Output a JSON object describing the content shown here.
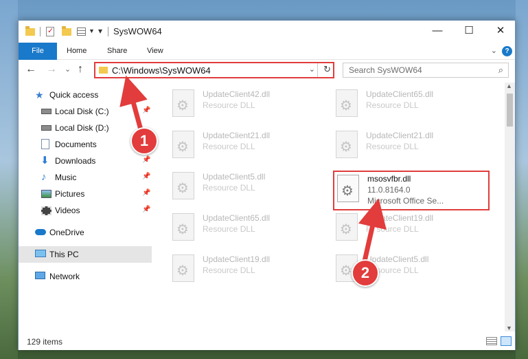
{
  "window": {
    "title": "SysWOW64",
    "minimize_glyph": "—",
    "maximize_glyph": "☐",
    "close_glyph": "✕"
  },
  "ribbon": {
    "tabs": [
      "File",
      "Home",
      "Share",
      "View"
    ],
    "help_glyph": "?"
  },
  "nav": {
    "back_glyph": "←",
    "forward_glyph": "→",
    "recent_glyph": "⌄",
    "up_glyph": "↑",
    "address": "C:\\Windows\\SysWOW64",
    "search_placeholder": "Search SysWOW64"
  },
  "sidebar": {
    "items": [
      {
        "label": "Quick access",
        "icon": "star-icon"
      },
      {
        "label": "Local Disk (C:)",
        "icon": "drive-icon"
      },
      {
        "label": "Local Disk (D:)",
        "icon": "drive-icon"
      },
      {
        "label": "Documents",
        "icon": "documents-icon"
      },
      {
        "label": "Downloads",
        "icon": "download-icon"
      },
      {
        "label": "Music",
        "icon": "music-icon"
      },
      {
        "label": "Pictures",
        "icon": "pictures-icon"
      },
      {
        "label": "Videos",
        "icon": "videos-icon"
      },
      {
        "label": "OneDrive",
        "icon": "cloud-icon"
      },
      {
        "label": "This PC",
        "icon": "pc-icon"
      },
      {
        "label": "Network",
        "icon": "network-icon"
      }
    ]
  },
  "files": {
    "left_col": [
      {
        "name": "UpdateClient42.dll",
        "type": "Resource DLL"
      },
      {
        "name": "UpdateClient21.dll",
        "type": "Resource DLL"
      },
      {
        "name": "UpdateClient5.dll",
        "type": "Resource DLL"
      },
      {
        "name": "UpdateClient65.dll",
        "type": "Resource DLL"
      },
      {
        "name": "UpdateClient19.dll",
        "type": "Resource DLL"
      }
    ],
    "right_col": [
      {
        "name": "UpdateClient65.dll",
        "type": "Resource DLL"
      },
      {
        "name": "UpdateClient21.dll",
        "type": "Resource DLL"
      },
      {
        "name": "UpdateClient19.dll",
        "type": "Resource DLL"
      },
      {
        "name": "UpdateClient5.dll",
        "type": "Resource DLL"
      }
    ],
    "highlighted": {
      "name": "msosvfbr.dll",
      "version": "11.0.8164.0",
      "description": "Microsoft Office Se..."
    }
  },
  "status": {
    "count": "129 items"
  },
  "annotations": {
    "step1": "1",
    "step2": "2",
    "color": "#e23c3c"
  }
}
